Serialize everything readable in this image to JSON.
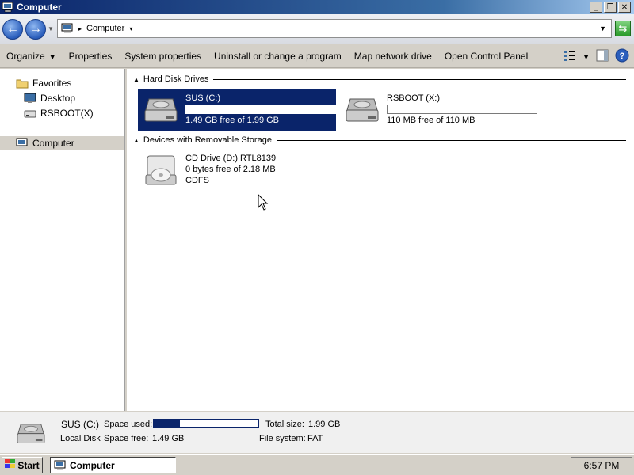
{
  "window": {
    "title": "Computer"
  },
  "address": {
    "crumb": "Computer"
  },
  "toolbar": {
    "organize": "Organize",
    "properties": "Properties",
    "system_properties": "System properties",
    "uninstall": "Uninstall or change a program",
    "map_drive": "Map network drive",
    "control_panel": "Open Control Panel"
  },
  "nav": {
    "favorites": "Favorites",
    "desktop": "Desktop",
    "rsboot": "RSBOOT(X)",
    "computer": "Computer"
  },
  "groups": {
    "hdd": "Hard Disk Drives",
    "removable": "Devices with Removable Storage"
  },
  "drives": [
    {
      "name": "SUS (C:)",
      "free_text": "1.49 GB free of 1.99 GB",
      "used_fraction": 0.25
    },
    {
      "name": "RSBOOT (X:)",
      "free_text": "110 MB free of 110 MB",
      "used_fraction": 0.0
    }
  ],
  "cd": {
    "name": "CD Drive (D:) RTL8139",
    "free_text": "0 bytes free of 2.18 MB",
    "fs": "CDFS"
  },
  "details": {
    "name": "SUS (C:)",
    "type": "Local Disk",
    "space_used_label": "Space used:",
    "space_used_fraction": 0.25,
    "space_free_label": "Space free:",
    "space_free": "1.49 GB",
    "total_size_label": "Total size:",
    "total_size": "1.99 GB",
    "fs_label": "File system:",
    "fs": "FAT"
  },
  "taskbar": {
    "start": "Start",
    "task": "Computer",
    "clock": "6:57 PM"
  }
}
